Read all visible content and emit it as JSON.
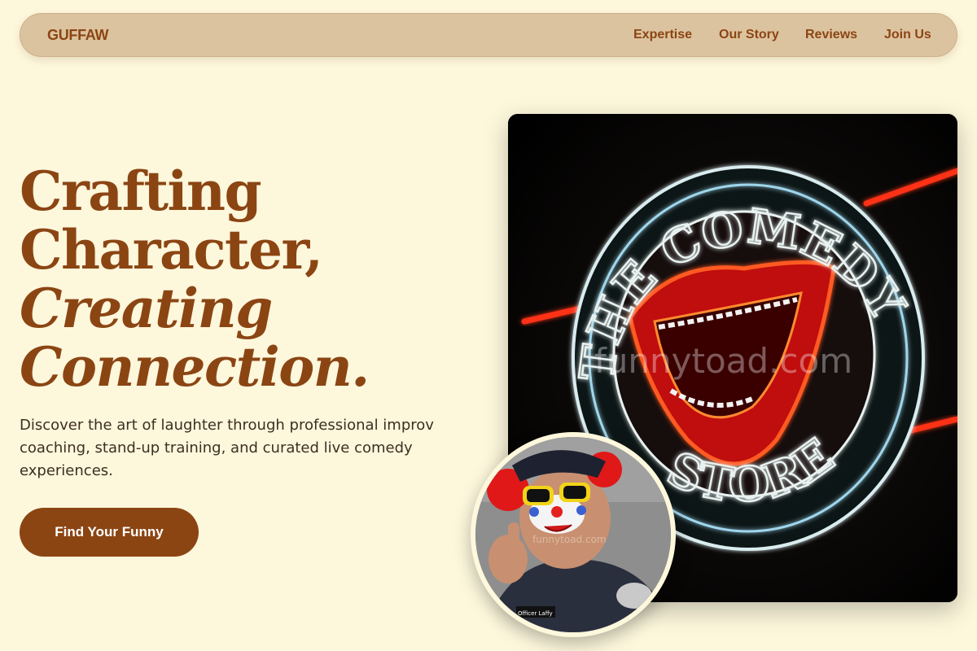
{
  "nav": {
    "brand": "GUFFAW",
    "links": [
      {
        "label": "Expertise"
      },
      {
        "label": "Our Story"
      },
      {
        "label": "Reviews"
      },
      {
        "label": "Join Us"
      }
    ]
  },
  "hero": {
    "headline": {
      "line1": "Crafting",
      "line2": "Character,",
      "line3": "Creating",
      "line4": "Connection."
    },
    "subtext": "Discover the art of laughter through professional improv coaching, stand-up training, and curated live comedy experiences.",
    "cta_label": "Find Your Funny"
  },
  "images": {
    "main_watermark": "funnytoad.com",
    "sign_text_top": "THE COMEDY",
    "sign_text_bottom": "STORE",
    "avatar_watermark": "funnytoad.com",
    "avatar_badge": "Officer Laffy"
  },
  "colors": {
    "background": "#fdf7dc",
    "accent": "#8b4513",
    "nav_background": "#dcc39f"
  }
}
